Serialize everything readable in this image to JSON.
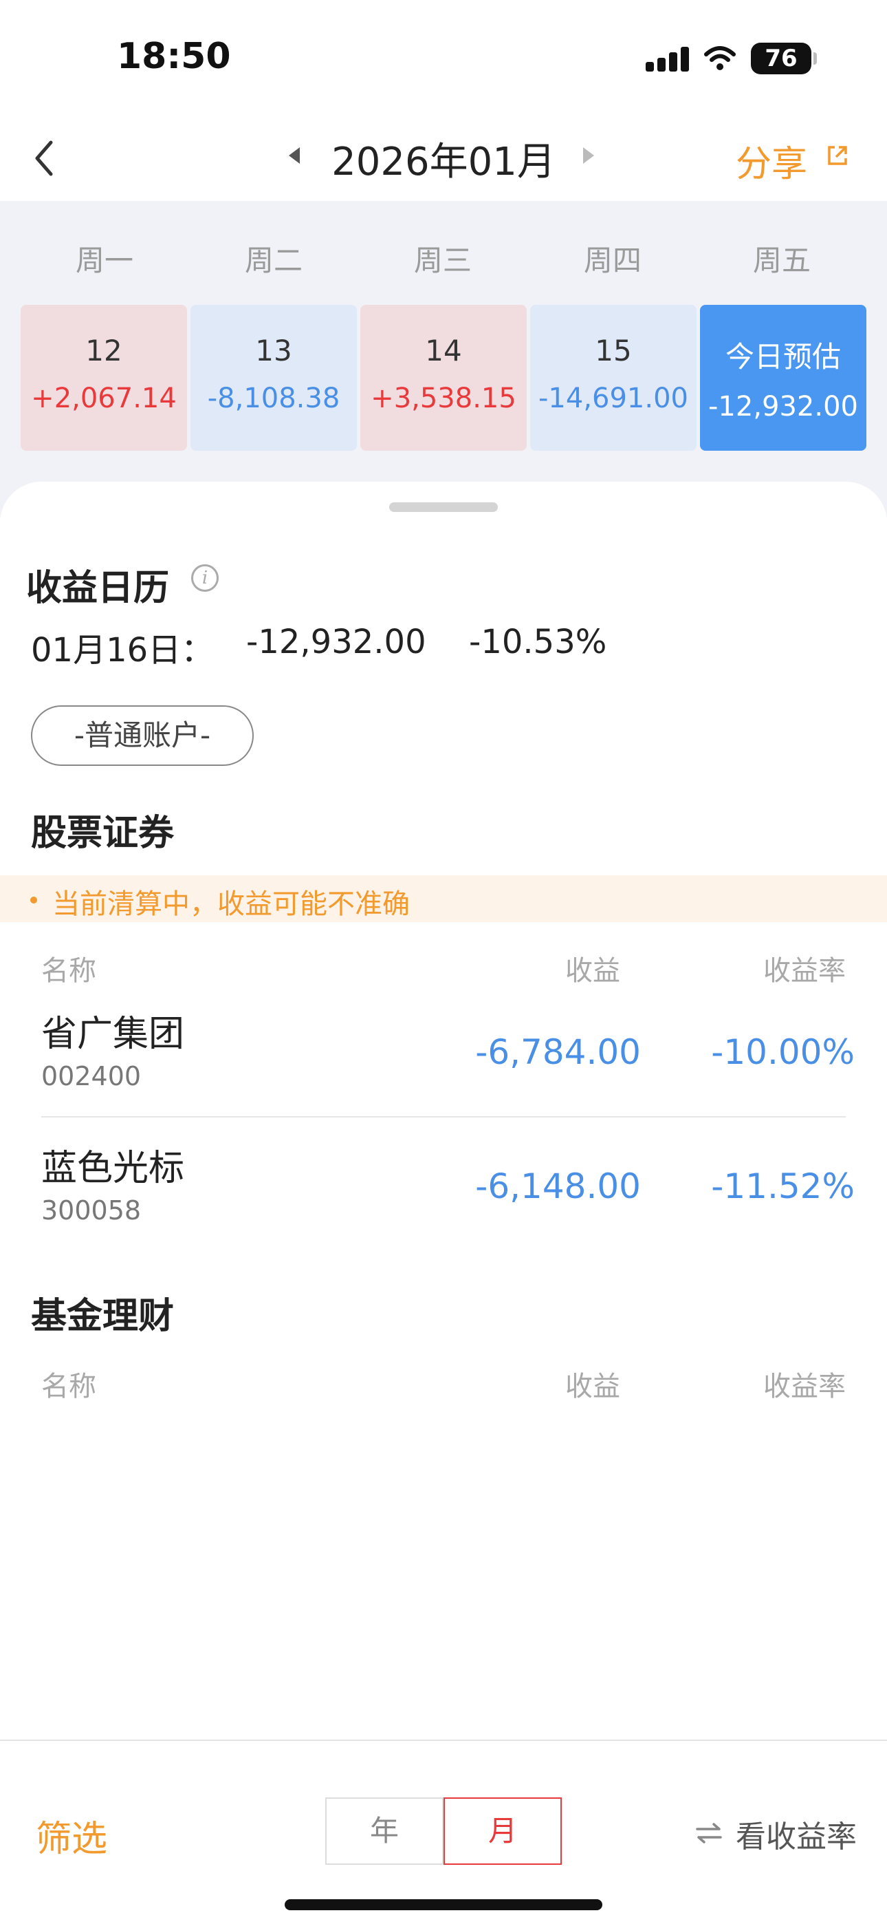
{
  "status_bar": {
    "time": "18:50",
    "battery": "76"
  },
  "nav": {
    "month": "2026年01月",
    "share": "分享"
  },
  "weekdays": [
    "周一",
    "周二",
    "周三",
    "周四",
    "周五"
  ],
  "days": [
    {
      "day": "12",
      "value": "+2,067.14"
    },
    {
      "day": "13",
      "value": "-8,108.38"
    },
    {
      "day": "14",
      "value": "+3,538.15"
    },
    {
      "day": "15",
      "value": "-14,691.00"
    },
    {
      "day": "今日预估",
      "value": "-12,932.00"
    }
  ],
  "calendar": {
    "title": "收益日历",
    "date_label": "01月16日：",
    "amount": "-12,932.00",
    "rate": "-10.53%"
  },
  "account_filter": "-普通账户-",
  "stocks": {
    "title": "股票证券",
    "warning": "当前清算中，收益可能不准确",
    "headers": {
      "name": "名称",
      "profit": "收益",
      "rate": "收益率"
    },
    "rows": [
      {
        "name": "省广集团",
        "code": "002400",
        "profit": "-6,784.00",
        "rate": "-10.00%"
      },
      {
        "name": "蓝色光标",
        "code": "300058",
        "profit": "-6,148.00",
        "rate": "-11.52%"
      }
    ]
  },
  "funds": {
    "title": "基金理财",
    "headers": {
      "name": "名称",
      "profit": "收益",
      "rate": "收益率"
    }
  },
  "bottom": {
    "filter": "筛选",
    "year": "年",
    "month": "月",
    "view_rate": "看收益率"
  },
  "colors": {
    "gain": "#e8393b",
    "loss": "#4a8fe6",
    "accent": "#f29a2e",
    "today": "#4a97f2"
  }
}
